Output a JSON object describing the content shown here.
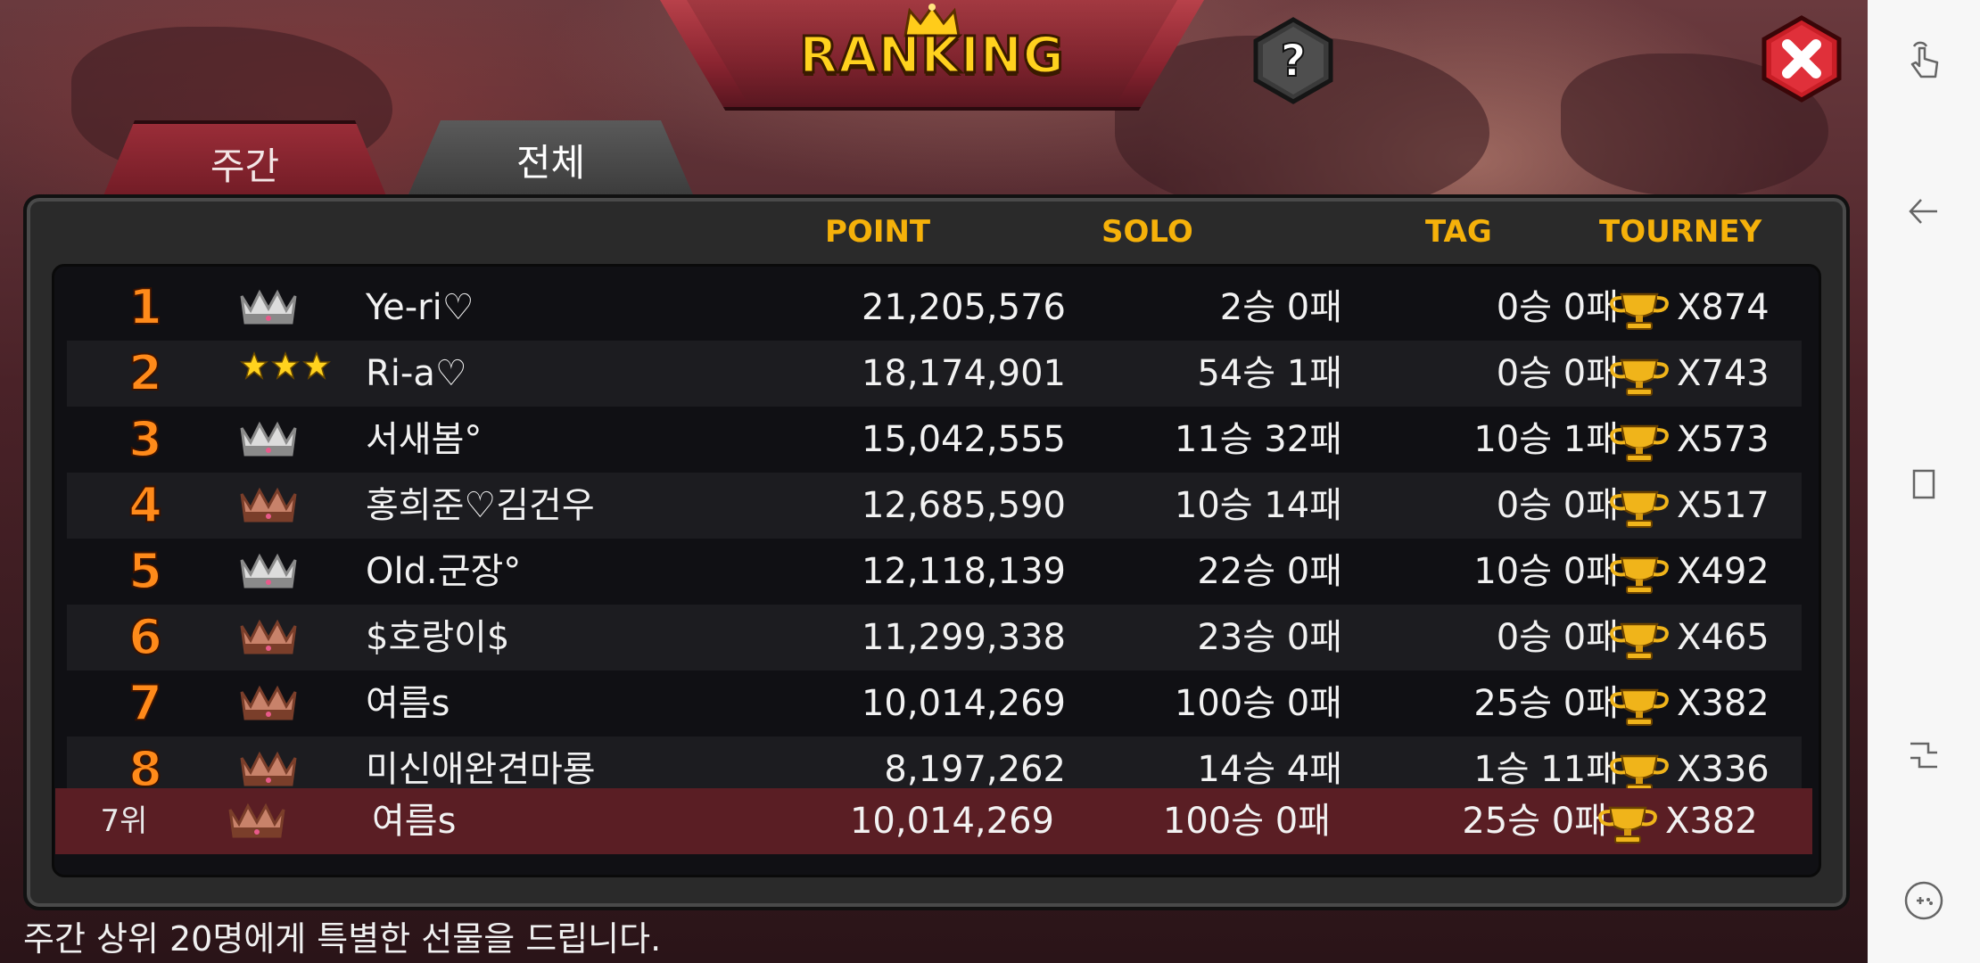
{
  "header": {
    "title": "RANKING",
    "help_label": "?",
    "close_icon": "close-icon"
  },
  "tabs": [
    {
      "label": "주간",
      "active": true
    },
    {
      "label": "전체",
      "active": false
    }
  ],
  "columns": {
    "point": "POINT",
    "solo": "SOLO",
    "tag": "TAG",
    "tourney": "TOURNEY"
  },
  "rows": [
    {
      "rank": "1",
      "badge": "silver-crown",
      "name": "Ye-ri♡",
      "point": "21,205,576",
      "solo": "2승 0패",
      "tag": "0승 0패",
      "tourney": "X874"
    },
    {
      "rank": "2",
      "badge": "three-stars",
      "name": "Ri-a♡",
      "point": "18,174,901",
      "solo": "54승 1패",
      "tag": "0승 0패",
      "tourney": "X743"
    },
    {
      "rank": "3",
      "badge": "silver-crown",
      "name": "서새봄°",
      "point": "15,042,555",
      "solo": "11승 32패",
      "tag": "10승 1패",
      "tourney": "X573"
    },
    {
      "rank": "4",
      "badge": "bronze-crown",
      "name": "홍희준♡김건우",
      "point": "12,685,590",
      "solo": "10승 14패",
      "tag": "0승 0패",
      "tourney": "X517"
    },
    {
      "rank": "5",
      "badge": "silver-crown",
      "name": "Old.군장°",
      "point": "12,118,139",
      "solo": "22승 0패",
      "tag": "10승 0패",
      "tourney": "X492"
    },
    {
      "rank": "6",
      "badge": "bronze-crown",
      "name": "$호랑이$",
      "point": "11,299,338",
      "solo": "23승 0패",
      "tag": "0승 0패",
      "tourney": "X465"
    },
    {
      "rank": "7",
      "badge": "bronze-crown",
      "name": "여름s",
      "point": "10,014,269",
      "solo": "100승 0패",
      "tag": "25승 0패",
      "tourney": "X382"
    },
    {
      "rank": "8",
      "badge": "bronze-crown",
      "name": "미신애완견마룡",
      "point": "8,197,262",
      "solo": "14승 4패",
      "tag": "1승 11패",
      "tourney": "X336"
    }
  ],
  "my_row": {
    "rank": "7위",
    "badge": "bronze-crown",
    "name": "여름s",
    "point": "10,014,269",
    "solo": "100승 0패",
    "tag": "25승 0패",
    "tourney": "X382"
  },
  "footer": "주간 상위 20명에게 특별한 선물을 드립니다.",
  "colors": {
    "accent_gold": "#f5b10a",
    "rank_orange": "#ff8a1a",
    "my_row_bg": "#5a1e24",
    "tab_active": "#8a2430"
  },
  "system_nav": [
    "touch-icon",
    "back-icon",
    "recent-apps-icon",
    "split-screen-icon",
    "game-tools-icon"
  ]
}
